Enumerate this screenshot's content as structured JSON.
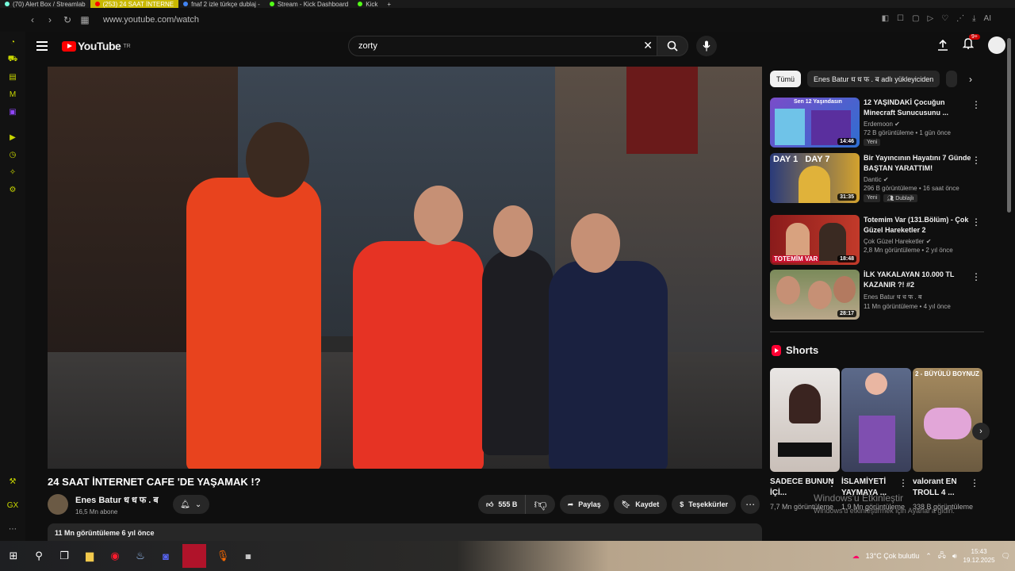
{
  "browser": {
    "tabs": [
      {
        "label": "(70) Alert Box / Streamlab",
        "active": false
      },
      {
        "label": "(253) 24 SAAT İNTERNE",
        "active": true
      },
      {
        "label": "fnaf 2 izle türkçe dublaj -",
        "active": false
      },
      {
        "label": "Stream - Kick Dashboard",
        "active": false
      },
      {
        "label": "Kick",
        "active": false
      }
    ],
    "url": "www.youtube.com/watch"
  },
  "yt": {
    "logo_text": "YouTube",
    "region": "TR",
    "search_value": "zorty",
    "notif_badge": "9+"
  },
  "video": {
    "title": "24 SAAT İNTERNET CAFE 'DE YAŞAMAK !?",
    "channel": "Enes Batur ध ध फ . ब",
    "subscribers": "16,5 Mn abone",
    "likes": "555 B",
    "share_label": "Paylaş",
    "save_label": "Kaydet",
    "thanks_label": "Teşekkürler",
    "desc_meta": "11 Mn görüntüleme  6 yıl önce"
  },
  "chips": [
    "Tümü",
    "Enes Batur ध ध फ . ब adlı yükleyiciden"
  ],
  "recommended": [
    {
      "title": "12 YAŞINDAKİ Çocuğun Minecraft Sunucusunu ...",
      "channel": "Erdemoon",
      "meta": "72 B görüntüleme • 1 gün önce",
      "duration": "14:46",
      "tags": [
        "Yeni"
      ],
      "thumb_text": "Sen 12 Yaşındasın"
    },
    {
      "title": "Bir Yayıncının Hayatını 7 Günde BAŞTAN YARATTIM!",
      "channel": "Dantic",
      "meta": "296 B görüntüleme • 16 saat önce",
      "duration": "31:35",
      "tags": [
        "Yeni",
        "Dublajlı"
      ],
      "thumb_text": "DAY 1   DAY 7"
    },
    {
      "title": "Totemim Var (131.Bölüm) - Çok Güzel Hareketler 2",
      "channel": "Çok Güzel Hareketler",
      "meta": "2,8 Mn görüntüleme • 2 yıl önce",
      "duration": "18:48",
      "tags": [],
      "thumb_text": "TOTEMİM VAR"
    },
    {
      "title": "İLK YAKALAYAN 10.000 TL KAZANIR ?! #2",
      "channel": "Enes Batur ध ध फ . ब",
      "meta": "11 Mn görüntüleme • 4 yıl önce",
      "duration": "28:17",
      "tags": [],
      "thumb_text": ""
    }
  ],
  "shorts": {
    "heading": "Shorts",
    "items": [
      {
        "title": "SADECE BUNUN İÇİ...",
        "views": "7,7 Mn görüntüleme"
      },
      {
        "title": "İSLAMİYETİ YAYMAYA ...",
        "views": "1,9 Mn görüntüleme"
      },
      {
        "title": "valorant EN TROLL 4 ...",
        "views": "338 B görüntüleme"
      }
    ],
    "thumb3_text": "2 - BÜYÜLÜ BOYNUZ"
  },
  "watermark": {
    "line1": "Windows'u Etkinleştir",
    "line2": "Windows'u etkinleştirmek için Ayarlar'a gidin."
  },
  "taskbar": {
    "weather": "13°C  Çok bulutlu",
    "time": "15:43",
    "date": "19.12.2025"
  },
  "colors": {
    "brand": "#ff0000",
    "background": "#0f0f0f",
    "browser_accent": "#c8d600"
  }
}
